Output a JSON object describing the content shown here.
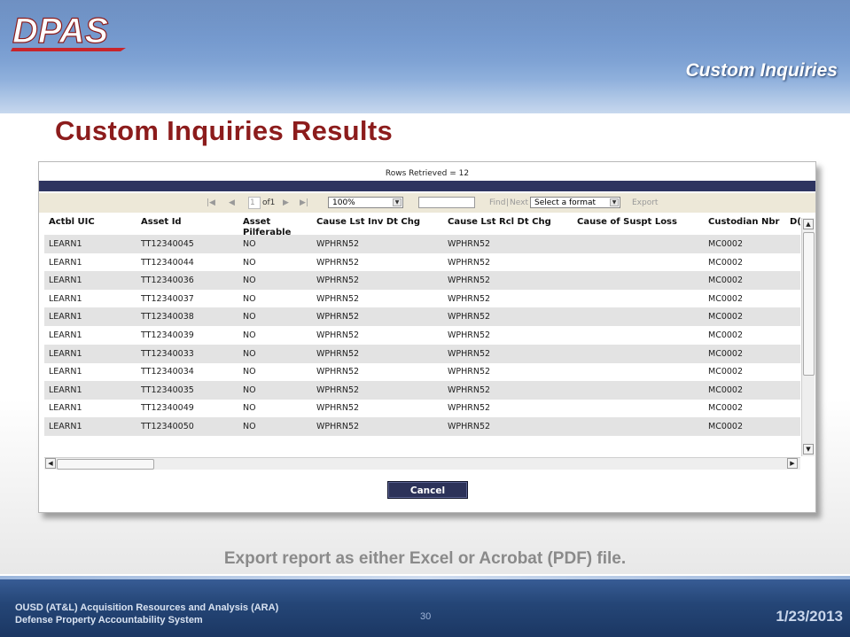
{
  "header": {
    "logo_text": "DPAS",
    "section_title": "Custom Inquiries"
  },
  "slide": {
    "title": "Custom Inquiries Results",
    "caption": "Export report as either Excel or Acrobat (PDF) file."
  },
  "report": {
    "rows_retrieved": "Rows Retrieved = 12",
    "toolbar": {
      "page_value": "1",
      "page_of": "of1",
      "zoom": "100%",
      "find_label": "Find",
      "separator": "|",
      "next_label": "Next",
      "format_placeholder": "Select a format",
      "export_label": "Export"
    },
    "columns": [
      "Actbl UIC",
      "Asset Id",
      "Asset\nPilferable",
      "Cause Lst Inv Dt Chg",
      "Cause Lst Rcl Dt Chg",
      "Cause of Suspt Loss",
      "Custodian Nbr",
      "D("
    ],
    "rows": [
      [
        "LEARN1",
        "TT12340045",
        "NO",
        "WPHRN52",
        "WPHRN52",
        "",
        "MC0002"
      ],
      [
        "LEARN1",
        "TT12340044",
        "NO",
        "WPHRN52",
        "WPHRN52",
        "",
        "MC0002"
      ],
      [
        "LEARN1",
        "TT12340036",
        "NO",
        "WPHRN52",
        "WPHRN52",
        "",
        "MC0002"
      ],
      [
        "LEARN1",
        "TT12340037",
        "NO",
        "WPHRN52",
        "WPHRN52",
        "",
        "MC0002"
      ],
      [
        "LEARN1",
        "TT12340038",
        "NO",
        "WPHRN52",
        "WPHRN52",
        "",
        "MC0002"
      ],
      [
        "LEARN1",
        "TT12340039",
        "NO",
        "WPHRN52",
        "WPHRN52",
        "",
        "MC0002"
      ],
      [
        "LEARN1",
        "TT12340033",
        "NO",
        "WPHRN52",
        "WPHRN52",
        "",
        "MC0002"
      ],
      [
        "LEARN1",
        "TT12340034",
        "NO",
        "WPHRN52",
        "WPHRN52",
        "",
        "MC0002"
      ],
      [
        "LEARN1",
        "TT12340035",
        "NO",
        "WPHRN52",
        "WPHRN52",
        "",
        "MC0002"
      ],
      [
        "LEARN1",
        "TT12340049",
        "NO",
        "WPHRN52",
        "WPHRN52",
        "",
        "MC0002"
      ],
      [
        "LEARN1",
        "TT12340050",
        "NO",
        "WPHRN52",
        "WPHRN52",
        "",
        "MC0002"
      ]
    ],
    "cancel_label": "Cancel"
  },
  "footer": {
    "org_line1": "OUSD (AT&L) Acquisition Resources and Analysis (ARA)",
    "org_line2": "Defense Property Accountability System",
    "page_number": "30",
    "date": "1/23/2013"
  },
  "colors": {
    "title_red": "#8c1c1c",
    "navy": "#2e3460",
    "header_blue": "#4f78b5"
  },
  "icons": [
    "first-page-icon",
    "prev-page-icon",
    "next-page-icon",
    "last-page-icon",
    "chevron-down-icon",
    "scroll-up-icon",
    "scroll-down-icon",
    "scroll-left-icon",
    "scroll-right-icon"
  ]
}
